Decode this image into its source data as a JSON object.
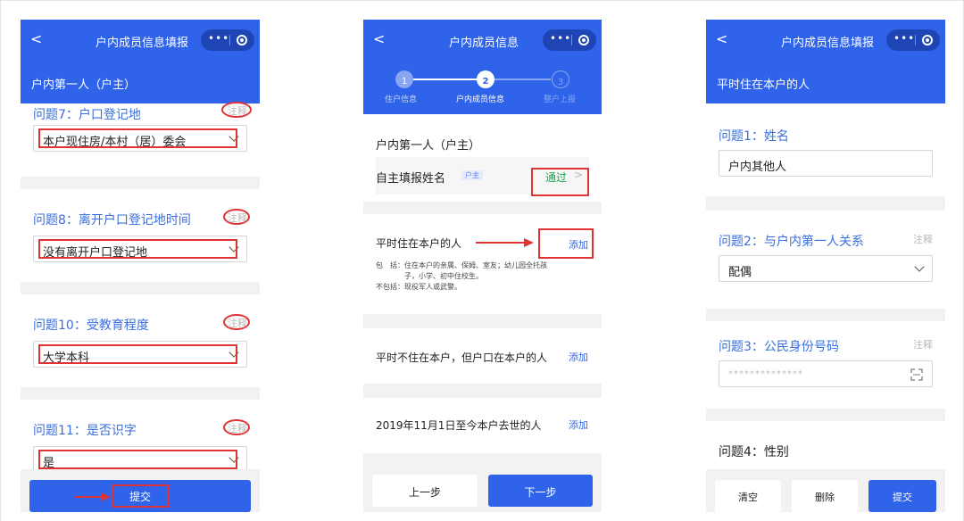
{
  "common": {
    "back": "<",
    "capsule_dots": "•••"
  },
  "panel1": {
    "title": "户内成员信息填报",
    "subtitle": "户内第一人（户主）",
    "questions": [
      {
        "label": "问题7：户口登记地",
        "note": "注释",
        "value": "本户现住房/本村（居）委会"
      },
      {
        "label": "问题8：离开户口登记地时间",
        "note": "注释",
        "value": "没有离开户口登记地"
      },
      {
        "label": "问题10：受教育程度",
        "note": "注释",
        "value": "大学本科"
      },
      {
        "label": "问题11：是否识字",
        "note": "注释",
        "value": "是"
      }
    ],
    "submit": "提交"
  },
  "panel2": {
    "title": "户内成员信息",
    "steps": [
      {
        "num": "1",
        "label": "住户信息"
      },
      {
        "num": "2",
        "label": "户内成员信息"
      },
      {
        "num": "3",
        "label": "整户上报"
      }
    ],
    "head_title": "户内第一人（户主）",
    "self_name": "自主填报姓名",
    "tag": "户主",
    "pass": "通过",
    "pass_arrow": ">",
    "sections": [
      {
        "title": "平时住在本户的人",
        "add": "添加"
      },
      {
        "title": "平时不住在本户，但户口在本户的人",
        "add": "添加"
      },
      {
        "title": "2019年11月1日至今本户去世的人",
        "add": "添加"
      }
    ],
    "include_label": "包　括：",
    "include_text1": "住在本户的亲属、保姆、室友；幼儿园全托孩",
    "include_text2": "子，小学、初中住校生。",
    "exclude_text": "不包括：现役军人或武警。",
    "prev": "上一步",
    "next": "下一步"
  },
  "panel3": {
    "title": "户内成员信息填报",
    "subtitle": "平时住在本户的人",
    "q1_label": "问题1：姓名",
    "q1_value": "户内其他人",
    "q2_label": "问题2：与户内第一人关系",
    "q2_note": "注释",
    "q2_value": "配偶",
    "q3_label": "问题3：公民身份号码",
    "q3_note": "注释",
    "q3_value": "**************",
    "q4_label": "问题4：性别",
    "buttons": {
      "clear": "清空",
      "delete": "删除",
      "submit": "提交"
    }
  },
  "colors": {
    "primary": "#2f63ea",
    "highlight": "#e03434",
    "pass_green": "#16a34a"
  }
}
